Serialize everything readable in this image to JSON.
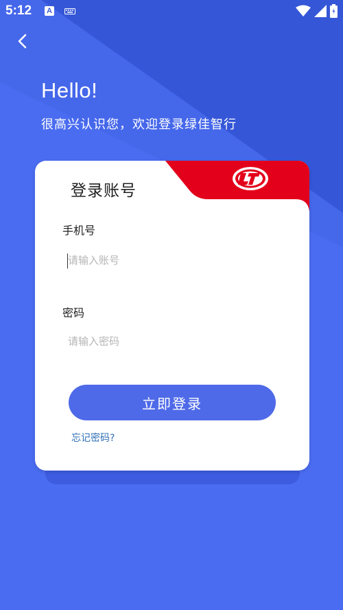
{
  "status_bar": {
    "time": "5:12",
    "a_icon_label": "A",
    "icons": [
      "a-icon",
      "keyboard-icon",
      "wifi-icon",
      "signal-icon",
      "battery-icon"
    ]
  },
  "header": {
    "back_icon": "chevron-left-icon",
    "hello": "Hello!",
    "welcome": "很高兴认识您，欢迎登录绿佳智行"
  },
  "card": {
    "title": "登录账号",
    "logo_icon": "brand-logo",
    "phone": {
      "label": "手机号",
      "placeholder": "请输入账号",
      "value": ""
    },
    "password": {
      "label": "密码",
      "placeholder": "请输入密码",
      "value": ""
    },
    "login_button": "立即登录",
    "forgot_link": "忘记密码?"
  },
  "colors": {
    "background": "#4a6cf0",
    "background_dark": "#2f4fcf",
    "button": "#4f6ae8",
    "accent_red": "#e3001b",
    "link": "#2f6fb6",
    "card": "#ffffff"
  }
}
